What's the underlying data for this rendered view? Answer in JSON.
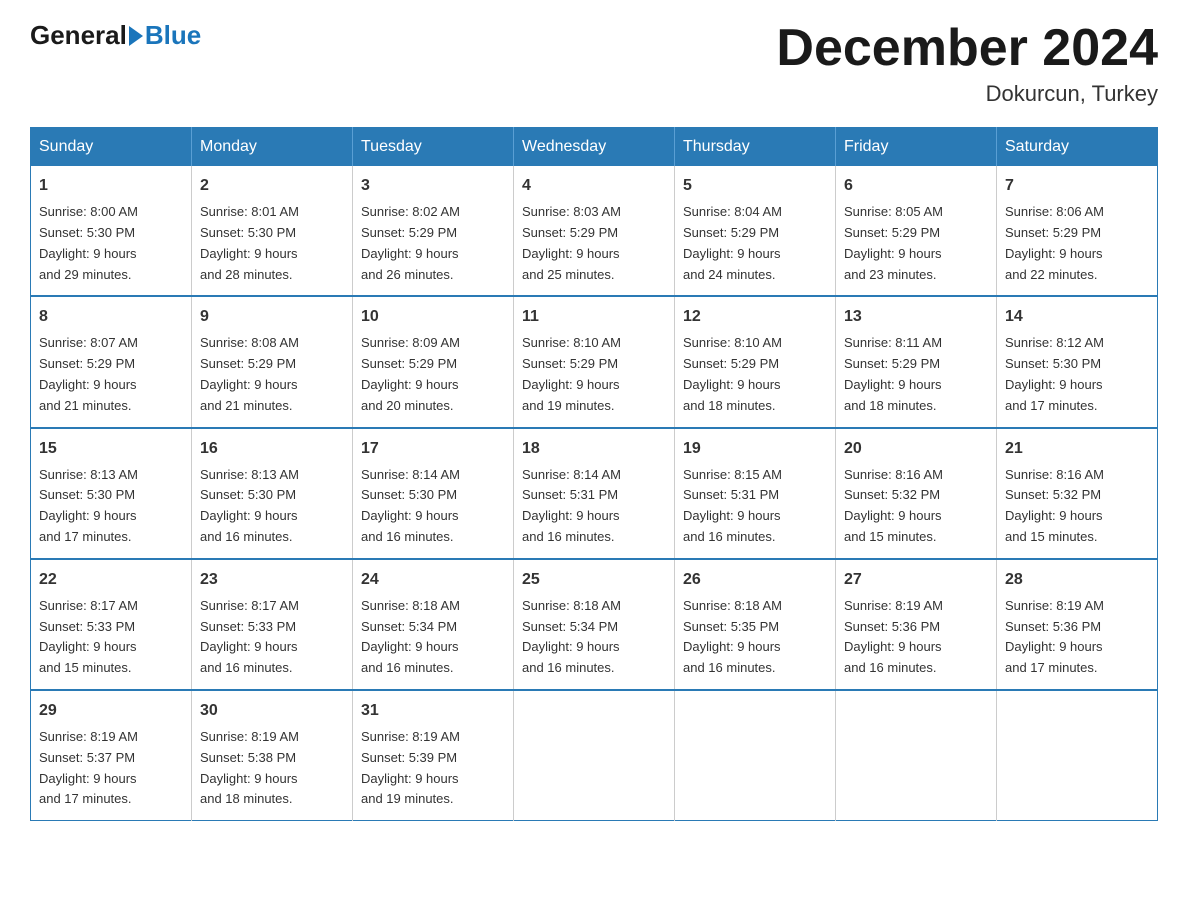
{
  "header": {
    "logo_general": "General",
    "logo_blue": "Blue",
    "month_title": "December 2024",
    "location": "Dokurcun, Turkey"
  },
  "days_of_week": [
    "Sunday",
    "Monday",
    "Tuesday",
    "Wednesday",
    "Thursday",
    "Friday",
    "Saturday"
  ],
  "weeks": [
    [
      {
        "day": "1",
        "sunrise": "8:00 AM",
        "sunset": "5:30 PM",
        "daylight": "9 hours and 29 minutes."
      },
      {
        "day": "2",
        "sunrise": "8:01 AM",
        "sunset": "5:30 PM",
        "daylight": "9 hours and 28 minutes."
      },
      {
        "day": "3",
        "sunrise": "8:02 AM",
        "sunset": "5:29 PM",
        "daylight": "9 hours and 26 minutes."
      },
      {
        "day": "4",
        "sunrise": "8:03 AM",
        "sunset": "5:29 PM",
        "daylight": "9 hours and 25 minutes."
      },
      {
        "day": "5",
        "sunrise": "8:04 AM",
        "sunset": "5:29 PM",
        "daylight": "9 hours and 24 minutes."
      },
      {
        "day": "6",
        "sunrise": "8:05 AM",
        "sunset": "5:29 PM",
        "daylight": "9 hours and 23 minutes."
      },
      {
        "day": "7",
        "sunrise": "8:06 AM",
        "sunset": "5:29 PM",
        "daylight": "9 hours and 22 minutes."
      }
    ],
    [
      {
        "day": "8",
        "sunrise": "8:07 AM",
        "sunset": "5:29 PM",
        "daylight": "9 hours and 21 minutes."
      },
      {
        "day": "9",
        "sunrise": "8:08 AM",
        "sunset": "5:29 PM",
        "daylight": "9 hours and 21 minutes."
      },
      {
        "day": "10",
        "sunrise": "8:09 AM",
        "sunset": "5:29 PM",
        "daylight": "9 hours and 20 minutes."
      },
      {
        "day": "11",
        "sunrise": "8:10 AM",
        "sunset": "5:29 PM",
        "daylight": "9 hours and 19 minutes."
      },
      {
        "day": "12",
        "sunrise": "8:10 AM",
        "sunset": "5:29 PM",
        "daylight": "9 hours and 18 minutes."
      },
      {
        "day": "13",
        "sunrise": "8:11 AM",
        "sunset": "5:29 PM",
        "daylight": "9 hours and 18 minutes."
      },
      {
        "day": "14",
        "sunrise": "8:12 AM",
        "sunset": "5:30 PM",
        "daylight": "9 hours and 17 minutes."
      }
    ],
    [
      {
        "day": "15",
        "sunrise": "8:13 AM",
        "sunset": "5:30 PM",
        "daylight": "9 hours and 17 minutes."
      },
      {
        "day": "16",
        "sunrise": "8:13 AM",
        "sunset": "5:30 PM",
        "daylight": "9 hours and 16 minutes."
      },
      {
        "day": "17",
        "sunrise": "8:14 AM",
        "sunset": "5:30 PM",
        "daylight": "9 hours and 16 minutes."
      },
      {
        "day": "18",
        "sunrise": "8:14 AM",
        "sunset": "5:31 PM",
        "daylight": "9 hours and 16 minutes."
      },
      {
        "day": "19",
        "sunrise": "8:15 AM",
        "sunset": "5:31 PM",
        "daylight": "9 hours and 16 minutes."
      },
      {
        "day": "20",
        "sunrise": "8:16 AM",
        "sunset": "5:32 PM",
        "daylight": "9 hours and 15 minutes."
      },
      {
        "day": "21",
        "sunrise": "8:16 AM",
        "sunset": "5:32 PM",
        "daylight": "9 hours and 15 minutes."
      }
    ],
    [
      {
        "day": "22",
        "sunrise": "8:17 AM",
        "sunset": "5:33 PM",
        "daylight": "9 hours and 15 minutes."
      },
      {
        "day": "23",
        "sunrise": "8:17 AM",
        "sunset": "5:33 PM",
        "daylight": "9 hours and 16 minutes."
      },
      {
        "day": "24",
        "sunrise": "8:18 AM",
        "sunset": "5:34 PM",
        "daylight": "9 hours and 16 minutes."
      },
      {
        "day": "25",
        "sunrise": "8:18 AM",
        "sunset": "5:34 PM",
        "daylight": "9 hours and 16 minutes."
      },
      {
        "day": "26",
        "sunrise": "8:18 AM",
        "sunset": "5:35 PM",
        "daylight": "9 hours and 16 minutes."
      },
      {
        "day": "27",
        "sunrise": "8:19 AM",
        "sunset": "5:36 PM",
        "daylight": "9 hours and 16 minutes."
      },
      {
        "day": "28",
        "sunrise": "8:19 AM",
        "sunset": "5:36 PM",
        "daylight": "9 hours and 17 minutes."
      }
    ],
    [
      {
        "day": "29",
        "sunrise": "8:19 AM",
        "sunset": "5:37 PM",
        "daylight": "9 hours and 17 minutes."
      },
      {
        "day": "30",
        "sunrise": "8:19 AM",
        "sunset": "5:38 PM",
        "daylight": "9 hours and 18 minutes."
      },
      {
        "day": "31",
        "sunrise": "8:19 AM",
        "sunset": "5:39 PM",
        "daylight": "9 hours and 19 minutes."
      },
      null,
      null,
      null,
      null
    ]
  ],
  "labels": {
    "sunrise": "Sunrise:",
    "sunset": "Sunset:",
    "daylight": "Daylight:"
  }
}
